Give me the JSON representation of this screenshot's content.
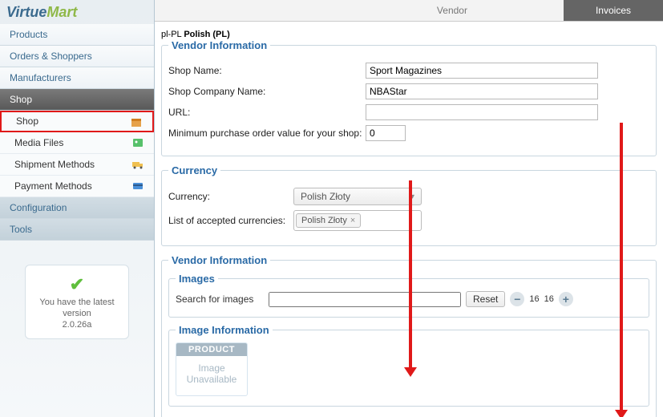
{
  "logo": {
    "part1": "Virtue",
    "part2": "Mart"
  },
  "nav": {
    "products": "Products",
    "orders": "Orders & Shoppers",
    "manufacturers": "Manufacturers",
    "shop": "Shop",
    "configuration": "Configuration",
    "tools": "Tools"
  },
  "sub": {
    "shop": "Shop",
    "media": "Media Files",
    "shipment": "Shipment Methods",
    "payment": "Payment Methods"
  },
  "update": {
    "line1": "You have the latest version",
    "line2": "2.0.26a"
  },
  "tabs": {
    "vendor": "Vendor",
    "invoices": "Invoices"
  },
  "locale_code": "pl-PL ",
  "locale_label": "Polish (PL)",
  "fieldsets": {
    "vendor_info": "Vendor Information",
    "currency": "Currency",
    "vendor_info2": "Vendor Information",
    "images": "Images",
    "image_info": "Image Information"
  },
  "labels": {
    "shop_name": "Shop Name:",
    "shop_company": "Shop Company Name:",
    "url": "URL:",
    "min_purchase": "Minimum purchase order value for your shop:",
    "currency": "Currency:",
    "accepted": "List of accepted currencies:",
    "search_images": "Search for images",
    "reset": "Reset"
  },
  "values": {
    "shop_name": "Sport Magazines",
    "shop_company": "NBAStar",
    "url": "",
    "min_purchase": "0",
    "currency": "Polish Złoty",
    "accepted_token": "Polish Złoty",
    "search_images": "",
    "page": "16",
    "page2": "16"
  },
  "thumb": {
    "header": "PRODUCT",
    "line1": "Image",
    "line2": "Unavailable"
  }
}
